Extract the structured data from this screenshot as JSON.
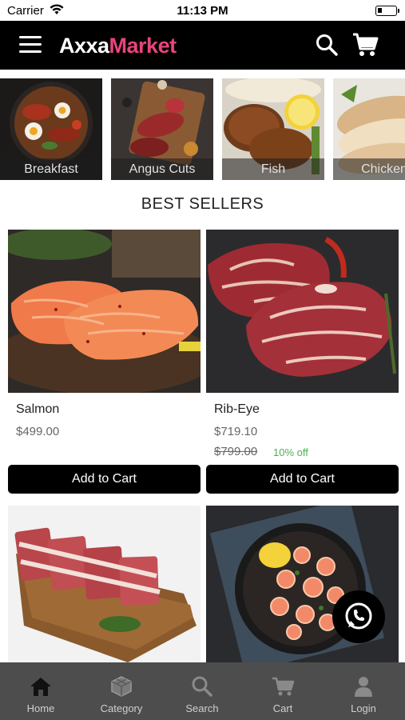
{
  "status_bar": {
    "carrier": "Carrier",
    "time": "11:13 PM"
  },
  "header": {
    "logo_part1": "Axxa",
    "logo_part2": "Market",
    "accent_color": "#e8447a"
  },
  "categories": [
    {
      "label": "Breakfast"
    },
    {
      "label": "Angus Cuts"
    },
    {
      "label": "Fish"
    },
    {
      "label": "Chicken"
    }
  ],
  "section_title": "BEST SELLERS",
  "products": [
    {
      "name": "Salmon",
      "price": "$499.00",
      "button": "Add to Cart"
    },
    {
      "name": "Rib-Eye",
      "price": "$719.10",
      "old_price": "$799.00",
      "discount": "10% off",
      "button": "Add to Cart"
    }
  ],
  "bottom_nav": [
    {
      "label": "Home",
      "icon": "home-icon"
    },
    {
      "label": "Category",
      "icon": "category-icon"
    },
    {
      "label": "Search",
      "icon": "search-icon"
    },
    {
      "label": "Cart",
      "icon": "cart-icon"
    },
    {
      "label": "Login",
      "icon": "user-icon"
    }
  ]
}
